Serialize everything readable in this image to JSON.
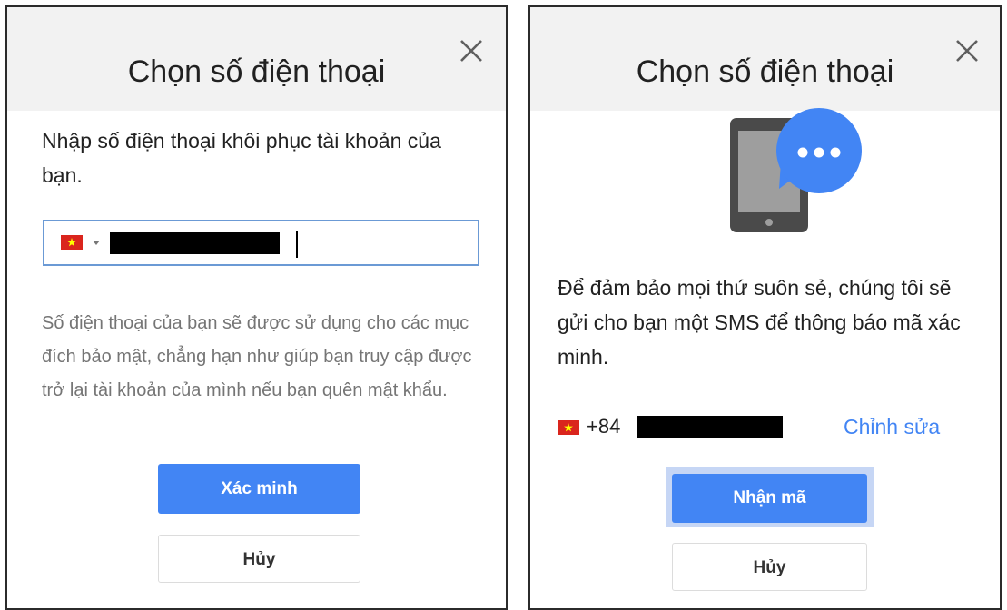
{
  "left": {
    "title": "Chọn số điện thoại",
    "prompt": "Nhập số điện thoại khôi phục tài khoản của bạn.",
    "help": "Số điện thoại của bạn sẽ được sử dụng cho các mục đích bảo mật, chẳng hạn như giúp bạn truy cập được trở lại tài khoản của mình nếu bạn quên mật khẩu.",
    "verify_button": "Xác minh",
    "cancel_button": "Hủy"
  },
  "right": {
    "title": "Chọn số điện thoại",
    "message": "Để đảm bảo mọi thứ suôn sẻ, chúng tôi sẽ gửi cho bạn một SMS để thông báo mã xác minh.",
    "country_code": "+84",
    "edit_link": "Chỉnh sửa",
    "get_code_button": "Nhận mã",
    "cancel_button": "Hủy"
  },
  "colors": {
    "accent": "#4285f4",
    "header_bg": "#f2f2f2",
    "flag_red": "#da251d",
    "flag_star": "#ffff00"
  },
  "icons": [
    "close-icon",
    "vietnam-flag-icon",
    "dropdown-caret-icon",
    "phone-sms-icon"
  ]
}
